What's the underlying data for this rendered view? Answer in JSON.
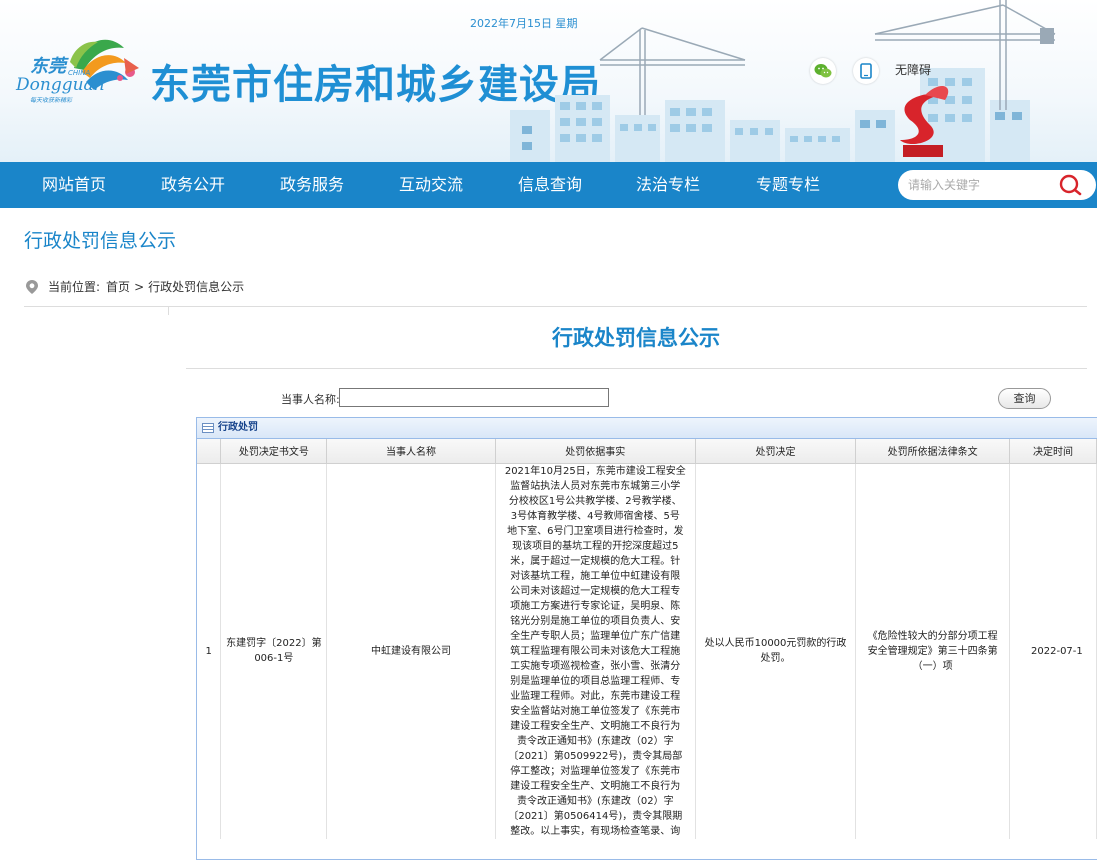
{
  "header": {
    "date_text": "2022年7月15日 星期",
    "logo_text_main": "东莞",
    "logo_text_china": "CHINA",
    "logo_text_en": "Dongguan",
    "logo_slogan": "每天收获新精彩",
    "site_title": "东莞市住房和城乡建设局",
    "accessibility_label": "无障碍"
  },
  "nav": {
    "items": [
      {
        "label": "网站首页"
      },
      {
        "label": "政务公开"
      },
      {
        "label": "政务服务"
      },
      {
        "label": "互动交流"
      },
      {
        "label": "信息查询"
      },
      {
        "label": "法治专栏"
      },
      {
        "label": "专题专栏"
      }
    ],
    "search_placeholder": "请输入关键字"
  },
  "page": {
    "title": "行政处罚信息公示",
    "breadcrumb_label": "当前位置:",
    "breadcrumb_home": "首页",
    "breadcrumb_separator": ">",
    "breadcrumb_current": "行政处罚信息公示",
    "content_title": "行政处罚信息公示"
  },
  "filter": {
    "label": "当事人名称:",
    "value": "",
    "query_label": "查询"
  },
  "table": {
    "panel_title": "行政处罚",
    "columns": [
      "处罚决定书文号",
      "当事人名称",
      "处罚依据事实",
      "处罚决定",
      "处罚所依据法律条文",
      "决定时间"
    ],
    "rows": [
      {
        "index": "1",
        "doc_no": "东建罚字〔2022〕第006-1号",
        "party": "中虹建设有限公司",
        "fact_lines": [
          "2021年10月25日，东莞市建设工程安全",
          "监督站执法人员对东莞市东城第三小学",
          "分校校区1号公共教学楼、2号教学楼、",
          "3号体育教学楼、4号教师宿舍楼、5号",
          "地下室、6号门卫室项目进行检查时，发",
          "现该项目的基坑工程的开挖深度超过5",
          "米，属于超过一定规模的危大工程。针",
          "对该基坑工程，施工单位中虹建设有限",
          "公司未对该超过一定规模的危大工程专",
          "项施工方案进行专家论证，吴明泉、陈",
          "铭光分别是施工单位的项目负责人、安",
          "全生产专职人员；监理单位广东广信建",
          "筑工程监理有限公司未对该危大工程施",
          "工实施专项巡视检查，张小雪、张清分",
          "别是监理单位的项目总监理工程师、专",
          "业监理工程师。对此，东莞市建设工程",
          "安全监督站对施工单位签发了《东莞市",
          "建设工程安全生产、文明施工不良行为",
          "责令改正通知书》(东建改（02）字",
          "〔2021〕第0509922号)，责令其局部",
          "停工整改；对监理单位签发了《东莞市",
          "建设工程安全生产、文明施工不良行为",
          "责令改正通知书》(东建改（02）字",
          "〔2021〕第0506414号)，责令其限期",
          "整改。以上事实，有现场检查笔录、询"
        ],
        "decision": "处以人民币10000元罚款的行政处罚。",
        "law": "《危险性较大的分部分项工程安全管理规定》第三十四条第（一）项",
        "date": "2022-07-1"
      }
    ]
  }
}
